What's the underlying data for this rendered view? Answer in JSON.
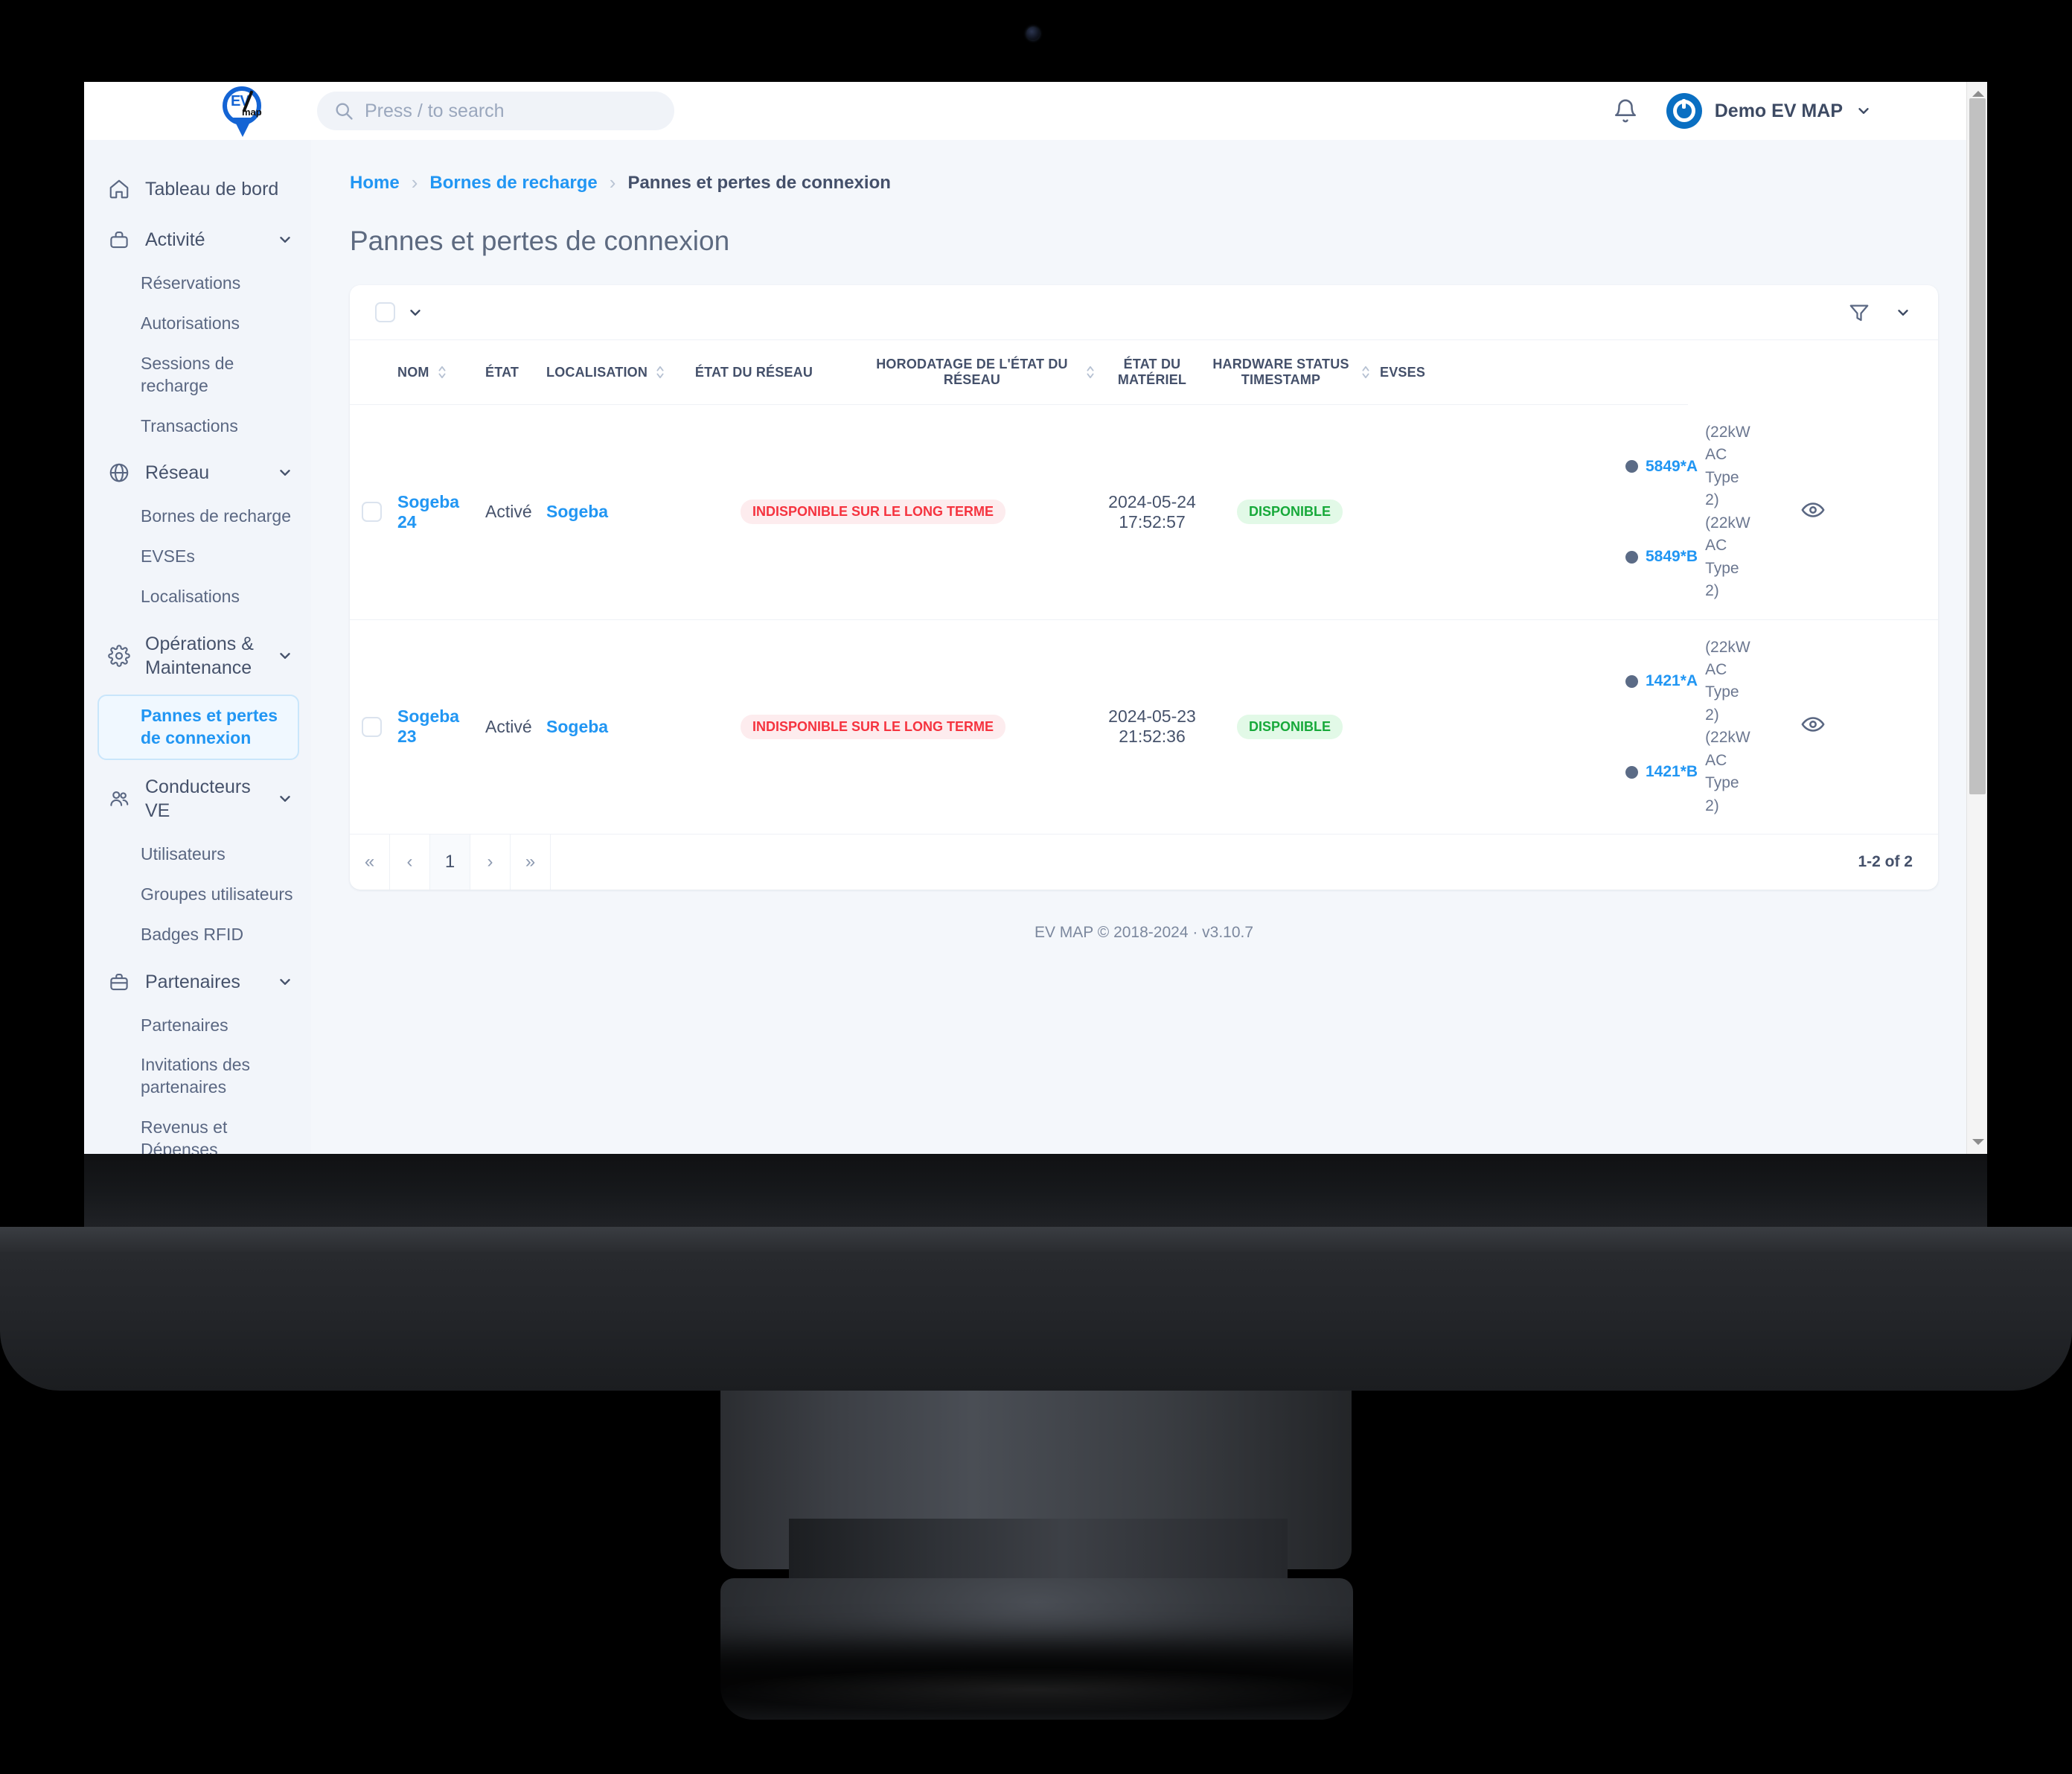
{
  "header": {
    "logo_ev": "EV",
    "logo_map": "map",
    "search_placeholder": "Press / to search",
    "user_name": "Demo EV MAP"
  },
  "sidebar": {
    "groups": [
      {
        "label": "Tableau de bord",
        "icon": "home-icon",
        "children": []
      },
      {
        "label": "Activité",
        "icon": "briefcase-icon",
        "children": [
          {
            "label": "Réservations"
          },
          {
            "label": "Autorisations"
          },
          {
            "label": "Sessions de recharge"
          },
          {
            "label": "Transactions"
          }
        ]
      },
      {
        "label": "Réseau",
        "icon": "globe-icon",
        "children": [
          {
            "label": "Bornes de recharge"
          },
          {
            "label": "EVSEs"
          },
          {
            "label": "Localisations"
          }
        ]
      },
      {
        "label": "Opérations & Maintenance",
        "icon": "gear-icon",
        "children": [
          {
            "label": "Pannes et pertes de connexion",
            "active": true
          }
        ]
      },
      {
        "label": "Conducteurs VE",
        "icon": "users-icon",
        "children": [
          {
            "label": "Utilisateurs"
          },
          {
            "label": "Groupes utilisateurs"
          },
          {
            "label": "Badges RFID"
          }
        ]
      },
      {
        "label": "Partenaires",
        "icon": "suitcase-icon",
        "children": [
          {
            "label": "Partenaires"
          },
          {
            "label": "Invitations des partenaires"
          },
          {
            "label": "Revenus et Dépenses"
          }
        ]
      }
    ]
  },
  "breadcrumb": {
    "items": [
      "Home",
      "Bornes de recharge",
      "Pannes et pertes de connexion"
    ],
    "separator": "›"
  },
  "page": {
    "title": "Pannes et pertes de connexion"
  },
  "table": {
    "columns": [
      {
        "label": "NOM",
        "sortable": true
      },
      {
        "label": "ÉTAT",
        "sortable": false
      },
      {
        "label": "LOCALISATION",
        "sortable": true
      },
      {
        "label": "ÉTAT DU RÉSEAU",
        "sortable": false
      },
      {
        "label": "HORODATAGE DE L'ÉTAT DU RÉSEAU",
        "sortable": true
      },
      {
        "label": "ÉTAT DU MATÉRIEL",
        "sortable": false
      },
      {
        "label": "HARDWARE STATUS TIMESTAMP",
        "sortable": true
      },
      {
        "label": "EVSES",
        "sortable": false
      },
      {
        "label": "",
        "sortable": false
      }
    ],
    "rows": [
      {
        "nom": "Sogeba 24",
        "etat": "Activé",
        "localisation": "Sogeba",
        "etat_reseau": "INDISPONIBLE SUR LE LONG TERME",
        "horodatage_reseau": "2024-05-24 17:52:57",
        "etat_materiel": "DISPONIBLE",
        "hardware_timestamp": "",
        "evses": [
          {
            "id": "5849*A",
            "spec": "(22kW AC Type 2)"
          },
          {
            "id": "5849*B",
            "spec": "(22kW AC Type 2)"
          }
        ],
        "action_icon": "eye-icon"
      },
      {
        "nom": "Sogeba 23",
        "etat": "Activé",
        "localisation": "Sogeba",
        "etat_reseau": "INDISPONIBLE SUR LE LONG TERME",
        "horodatage_reseau": "2024-05-23 21:52:36",
        "etat_materiel": "DISPONIBLE",
        "hardware_timestamp": "",
        "evses": [
          {
            "id": "1421*A",
            "spec": "(22kW AC Type 2)"
          },
          {
            "id": "1421*B",
            "spec": "(22kW AC Type 2)"
          }
        ],
        "action_icon": "eye-icon"
      }
    ]
  },
  "pagination": {
    "first": "«",
    "prev": "‹",
    "current": "1",
    "next": "›",
    "last": "»",
    "count": "1-2 of 2"
  },
  "footer": {
    "text": "EV MAP © 2018-2024 · v3.10.7"
  },
  "colors": {
    "accent": "#2196f3",
    "brand_blue": "#1464d4",
    "danger": "#f5333f",
    "success": "#17a93a",
    "sidebar_bg": "#f2f5fa",
    "content_bg": "#f4f7fb"
  }
}
